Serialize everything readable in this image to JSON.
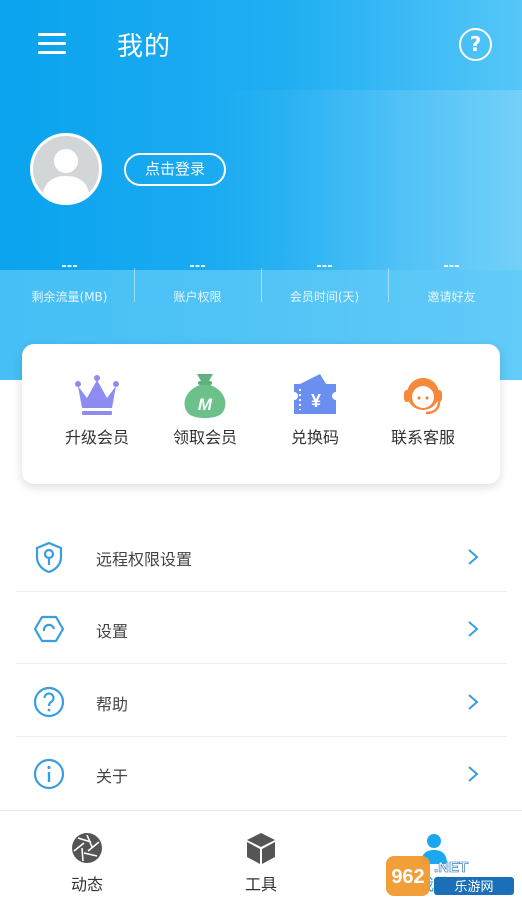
{
  "header": {
    "title": "我的",
    "menu_icon": "hamburger-menu-icon",
    "help_icon": "question-circle-icon"
  },
  "profile": {
    "avatar_icon": "default-user-avatar",
    "login_label": "点击登录"
  },
  "stats": [
    {
      "value": "---",
      "label": "剩余流量(MB)"
    },
    {
      "value": "---",
      "label": "账户权限"
    },
    {
      "value": "---",
      "label": "会员时间(天)"
    },
    {
      "value": "---",
      "label": "邀请好友"
    }
  ],
  "actions": [
    {
      "label": "升级会员",
      "icon": "crown-icon"
    },
    {
      "label": "领取会员",
      "icon": "money-bag-icon"
    },
    {
      "label": "兑换码",
      "icon": "yen-ticket-icon"
    },
    {
      "label": "联系客服",
      "icon": "customer-service-icon"
    }
  ],
  "menu": [
    {
      "label": "远程权限设置",
      "icon": "shield-key-icon"
    },
    {
      "label": "设置",
      "icon": "settings-hexagon-icon"
    },
    {
      "label": "帮助",
      "icon": "help-circle-icon"
    },
    {
      "label": "关于",
      "icon": "info-circle-icon"
    }
  ],
  "tabs": [
    {
      "label": "动态",
      "icon": "aperture-icon"
    },
    {
      "label": "工具",
      "icon": "cube-icon"
    },
    {
      "label": "我的",
      "icon": "person-icon"
    }
  ],
  "watermark": {
    "number": "962",
    "suffix": ".NET",
    "text": "乐游网"
  },
  "colors": {
    "primary": "#1aa9f0",
    "accent_icon": "#3a9de0",
    "crown": "#8e8cf0",
    "bag": "#6cc08a",
    "ticket": "#6a8ff0",
    "service": "#f5883a"
  }
}
